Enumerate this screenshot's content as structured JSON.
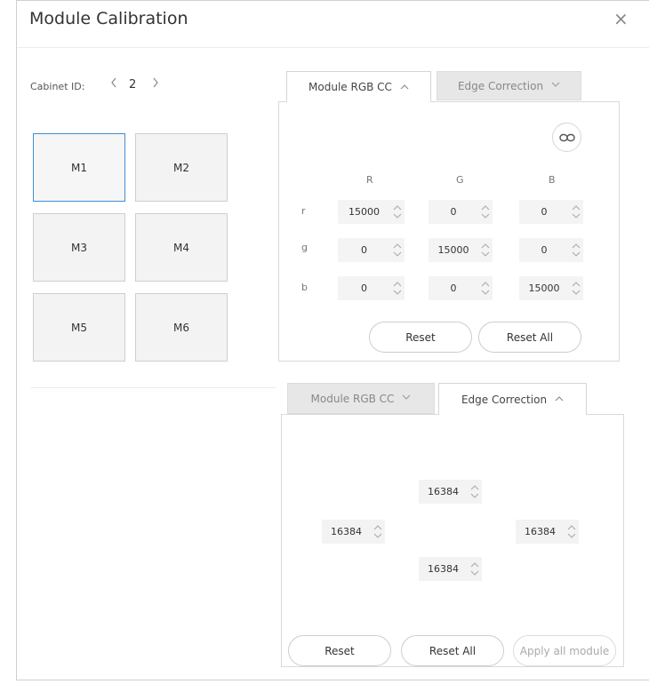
{
  "window": {
    "title": "Module Calibration",
    "close_glyph": "×"
  },
  "cabinet": {
    "label": "Cabinet ID:",
    "value": "2",
    "prev": "<",
    "next": ">"
  },
  "modules": [
    "M1",
    "M2",
    "M3",
    "M4",
    "M5",
    "M6"
  ],
  "selected_module": "M1",
  "rgb_panel": {
    "tabs": [
      {
        "label": "Module RGB CC",
        "caret": "^",
        "state": "active"
      },
      {
        "label": "Edge Correction",
        "caret": "v",
        "state": "inactive"
      }
    ],
    "columns": [
      "R",
      "G",
      "B"
    ],
    "rows": [
      {
        "label": "r",
        "values": [
          "15000",
          "0",
          "0"
        ]
      },
      {
        "label": "g",
        "values": [
          "0",
          "15000",
          "0"
        ]
      },
      {
        "label": "b",
        "values": [
          "0",
          "0",
          "15000"
        ]
      }
    ],
    "reset_label": "Reset",
    "reset_all_label": "Reset All",
    "link_icon": "link-icon"
  },
  "edge_panel": {
    "tabs": [
      {
        "label": "Module RGB CC",
        "caret": "v",
        "state": "inactive"
      },
      {
        "label": "Edge Correction",
        "caret": "^",
        "state": "active"
      }
    ],
    "top": "16384",
    "left": "16384",
    "right": "16384",
    "bottom": "16384",
    "reset_label": "Reset",
    "reset_all_label": "Reset All",
    "apply_label": "Apply all module"
  },
  "colors": {
    "selected_border": "#3d8fd6",
    "tab_inactive_bg": "#e7e7e7",
    "spin_bg": "#f4f4f4"
  }
}
